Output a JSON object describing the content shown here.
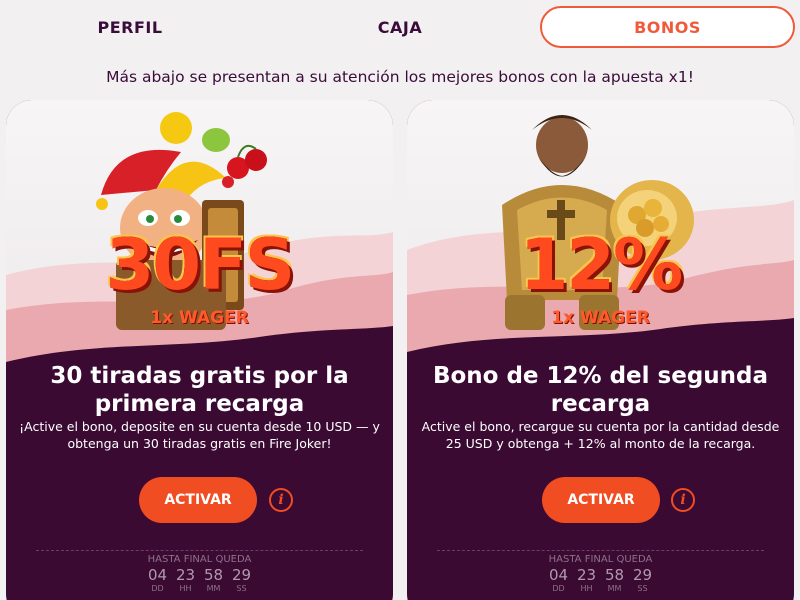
{
  "tabs": [
    {
      "label": "PERFIL"
    },
    {
      "label": "CAJA"
    },
    {
      "label": "BONOS",
      "active": true
    }
  ],
  "subtitle": "Más abajo se presentan a su atención los mejores bonos con la apuesta x1!",
  "colors": {
    "accent": "#f04d22",
    "dark": "#3a0a33",
    "headline": "#ff4a1f"
  },
  "cards": [
    {
      "art_icon": "joker-fruit-icon",
      "big_text": "30FS",
      "wager": "1x WAGER",
      "title": "30 tiradas gratis por la primera recarga",
      "description": "¡Active el bono, deposite en su cuenta desde 10 USD — y obtenga un 30 tiradas gratis en Fire Joker!",
      "button": "ACTIVAR",
      "info_icon": "info-icon",
      "timer_label": "HASTA FINAL QUEDA",
      "timer": [
        {
          "value": "04",
          "unit": "DD"
        },
        {
          "value": "23",
          "unit": "HH"
        },
        {
          "value": "58",
          "unit": "MM"
        },
        {
          "value": "29",
          "unit": "SS"
        }
      ]
    },
    {
      "art_icon": "warrior-coins-icon",
      "big_text": "12%",
      "wager": "1x WAGER",
      "title": "Bono de 12% del segunda recarga",
      "description": "Active el bono, recargue su cuenta por la cantidad desde 25 USD y obtenga + 12% al monto de la recarga.",
      "button": "ACTIVAR",
      "info_icon": "info-icon",
      "timer_label": "HASTA FINAL QUEDA",
      "timer": [
        {
          "value": "04",
          "unit": "DD"
        },
        {
          "value": "23",
          "unit": "HH"
        },
        {
          "value": "58",
          "unit": "MM"
        },
        {
          "value": "29",
          "unit": "SS"
        }
      ]
    }
  ]
}
